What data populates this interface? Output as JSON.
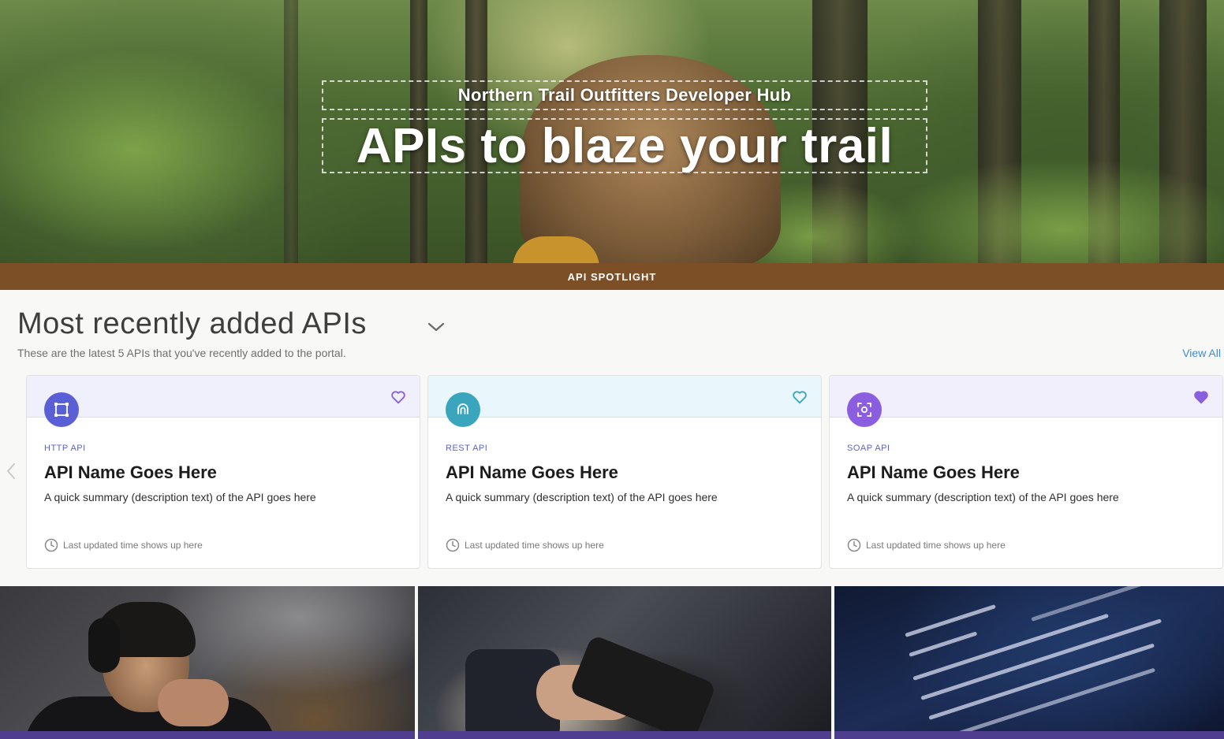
{
  "hero": {
    "subtitle": "Northern Trail Outfitters Developer Hub",
    "title": "APIs to blaze your trail"
  },
  "spotlight": {
    "label": "API SPOTLIGHT"
  },
  "section": {
    "title": "Most recently added APIs",
    "description": "These are the latest 5 APIs that you've recently added to the portal.",
    "view_all": "View All"
  },
  "cards": [
    {
      "type": "HTTP API",
      "name": "API Name Goes Here",
      "summary": "A quick summary (description text) of the API goes here",
      "time": "Last updated time shows up here",
      "icon": "http-api-icon",
      "accent": "#5a5fd6",
      "band": "#f0f0fc",
      "favorited": false
    },
    {
      "type": "REST API",
      "name": "API Name Goes Here",
      "summary": "A quick summary (description text) of the API goes here",
      "time": "Last updated time shows up here",
      "icon": "rest-api-icon",
      "accent": "#3aa6be",
      "band": "#e9f6fb",
      "favorited": false
    },
    {
      "type": "SOAP API",
      "name": "API Name Goes Here",
      "summary": "A quick summary (description text) of the API goes here",
      "time": "Last updated time shows up here",
      "icon": "soap-api-icon",
      "accent": "#8b5ee0",
      "band": "#f2effc",
      "favorited": true
    }
  ],
  "colors": {
    "spotlight_bar": "#7d4f27",
    "link": "#3b8dd6",
    "heart": "#8b5ee0"
  }
}
